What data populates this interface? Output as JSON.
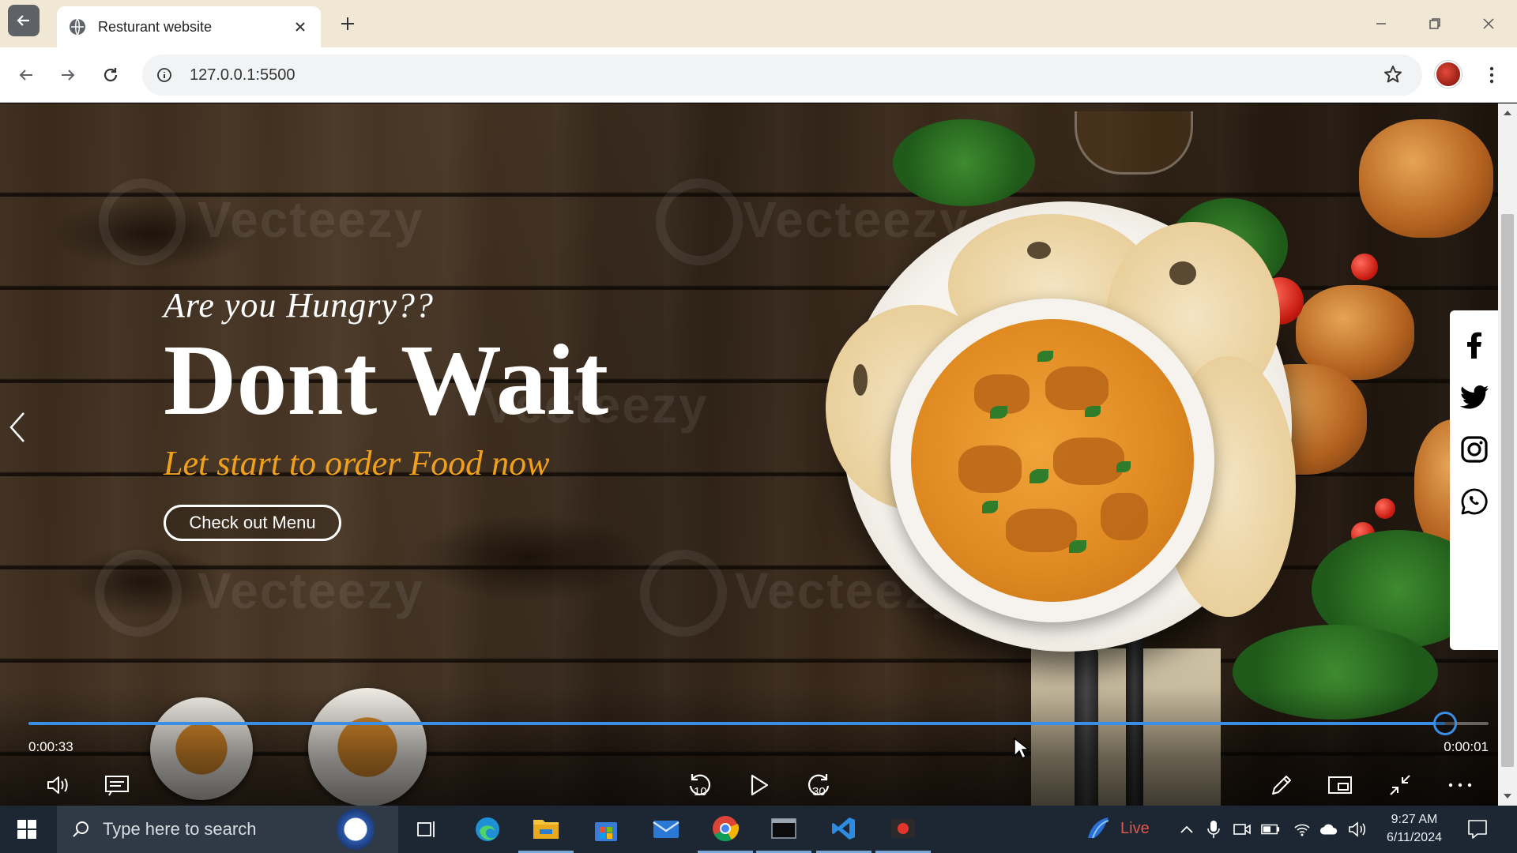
{
  "browser": {
    "tab_title": "Resturant website",
    "url": "127.0.0.1:5500"
  },
  "hero": {
    "kicker": "Are you Hungry??",
    "title": "Dont Wait",
    "subtitle": "Let start to order Food now",
    "button_label": "Check out Menu",
    "subtitle_color": "#f0a01a"
  },
  "watermark_text": "Vecteezy",
  "social": {
    "items": [
      "facebook-icon",
      "twitter-icon",
      "instagram-icon",
      "whatsapp-icon"
    ]
  },
  "player": {
    "elapsed": "0:00:33",
    "remaining": "0:00:01",
    "progress_fraction": 0.97,
    "accent": "#3a8ee6",
    "skip_back_seconds": "10",
    "skip_forward_seconds": "30"
  },
  "taskbar": {
    "search_placeholder": "Type here to search",
    "live_label": "Live",
    "time": "9:27 AM",
    "date": "6/11/2024"
  }
}
